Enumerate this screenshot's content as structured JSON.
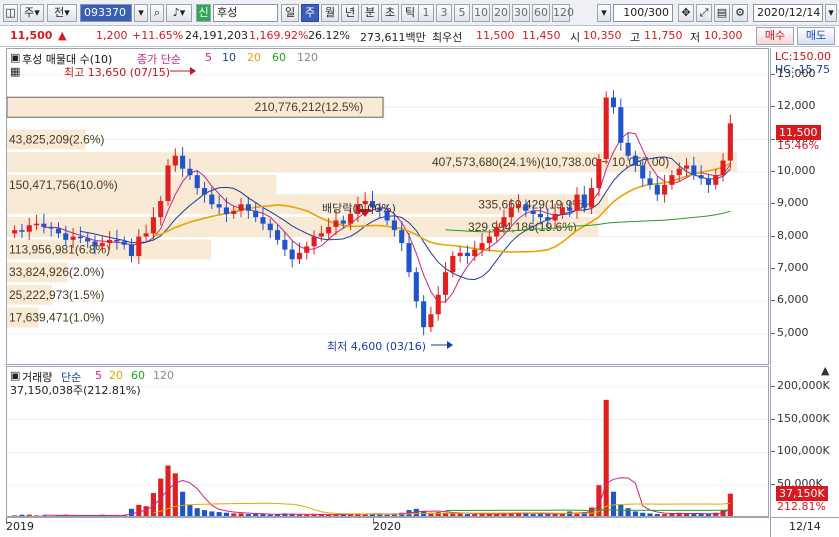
{
  "toolbar": {
    "market": "주",
    "prev": "전",
    "code": "093370",
    "name": "후성",
    "period_buttons": [
      "일",
      "주",
      "월",
      "년",
      "분",
      "초",
      "틱"
    ],
    "selected_period": "주",
    "interval_buttons": [
      "1",
      "3",
      "5",
      "10",
      "20",
      "30",
      "60",
      "120"
    ],
    "count": "100/300",
    "date": "2020/12/14",
    "new_badge": "신"
  },
  "quote": {
    "price": "11,500",
    "change_arrow": "▲",
    "change": "1,200",
    "change_pct": "+11.65%",
    "volume": "24,191,203",
    "volume_ratio": "1,169.92%",
    "turnover": "26.12%",
    "amount": "273,611백만",
    "best_ask_label": "최우선",
    "best_ask": "11,500",
    "best_bid": "11,450",
    "open_label": "시",
    "open": "10,350",
    "high_label": "고",
    "high": "11,750",
    "low_label": "저",
    "low": "10,300",
    "buy_button": "매수",
    "sell_button": "매도"
  },
  "price_panel": {
    "title": "후성 매물대 수(10)",
    "ma_label": "종가 단순",
    "ma_periods": [
      "5",
      "10",
      "20",
      "60",
      "120"
    ],
    "ma_colors": [
      "#cc2288",
      "#1a3c9e",
      "#e8a400",
      "#22a020",
      "#888888"
    ],
    "max_label": "최고 13,650 (07/15)",
    "min_label": "최저 4,600 (03/16)",
    "dividend_label": "배당락(0.00%)",
    "lc_label": "LC:150.00",
    "hc_label": "HC:-15.75",
    "axis_ticks": [
      "13,000",
      "12,000",
      "11,000",
      "10,000",
      "9,000",
      "8,000",
      "7,000",
      "6,000",
      "5,000"
    ],
    "current_price_tag": "11,500",
    "current_pct_tag": "15.46%",
    "volume_profile": [
      {
        "label": "210,776,212(12.5%)",
        "price": 12000,
        "value": 210776212
      },
      {
        "label": "43,825,209(2.6%)",
        "price": 11000,
        "value": 43825209
      },
      {
        "label": "407,573,680(24.1%)(10,738.00 ~ 10,057.00)",
        "price": 10300,
        "value": 407573680
      },
      {
        "label": "150,471,756(10.0%)",
        "price": 9600,
        "value": 150471756
      },
      {
        "label": "335,669,429(19.9%)",
        "price": 9000,
        "value": 335669429
      },
      {
        "label": "329,994,186(19.6%)",
        "price": 8300,
        "value": 329994186
      },
      {
        "label": "113,956,981(6.8%)",
        "price": 7600,
        "value": 113956981
      },
      {
        "label": "33,824,926(2.0%)",
        "price": 6900,
        "value": 33824926
      },
      {
        "label": "25,222,973(1.5%)",
        "price": 6200,
        "value": 25222973
      },
      {
        "label": "17,639,471(1.0%)",
        "price": 5500,
        "value": 17639471
      }
    ]
  },
  "volume_panel": {
    "title": "거래량",
    "ma_label": "단순",
    "ma_periods": [
      "5",
      "20",
      "60",
      "120"
    ],
    "last_value_label": "37,150,038주(212.81%)",
    "axis_ticks": [
      "200,000K",
      "150,000K",
      "100,000K",
      "50,000K"
    ],
    "current_vol_tag": "37,150K",
    "current_pct_tag": "212.81%"
  },
  "date_axis": {
    "labels": [
      "2019",
      "2020"
    ],
    "end_label": "12/14"
  },
  "chart_data": {
    "type": "candlestick",
    "title": "후성 매물대 수(10)",
    "weekly_close": [
      8200,
      8150,
      8350,
      8400,
      8300,
      8250,
      8100,
      7900,
      8000,
      7950,
      7850,
      7700,
      7800,
      7900,
      7850,
      7750,
      7400,
      8000,
      8100,
      8600,
      9100,
      10200,
      10500,
      10100,
      9900,
      9500,
      9300,
      9000,
      8900,
      8700,
      8800,
      9000,
      8800,
      8600,
      8400,
      8200,
      7900,
      7600,
      7300,
      7500,
      7700,
      8000,
      8100,
      8300,
      8500,
      8400,
      8700,
      9000,
      9100,
      8900,
      8800,
      8500,
      8200,
      7800,
      6900,
      6000,
      5200,
      5600,
      6200,
      6900,
      7400,
      7500,
      7400,
      7600,
      7800,
      8000,
      8300,
      8600,
      8900,
      9000,
      8800,
      8700,
      8600,
      8500,
      8700,
      8900,
      8800,
      9300,
      8900,
      9500,
      10400,
      12300,
      12000,
      10900,
      10500,
      10200,
      9800,
      9600,
      9300,
      9600,
      9900,
      10100,
      10200,
      9900,
      9800,
      9600,
      9900,
      10350,
      11500
    ],
    "weekly_volume": [
      4,
      5,
      5,
      4,
      4,
      3,
      4,
      5,
      4,
      3,
      3,
      4,
      5,
      4,
      4,
      4,
      14,
      20,
      18,
      38,
      60,
      80,
      68,
      40,
      20,
      15,
      12,
      10,
      9,
      8,
      7,
      7,
      6,
      6,
      6,
      5,
      6,
      7,
      6,
      5,
      5,
      5,
      6,
      5,
      5,
      6,
      6,
      7,
      6,
      6,
      6,
      5,
      7,
      8,
      12,
      14,
      10,
      8,
      9,
      8,
      7,
      7,
      6,
      6,
      6,
      6,
      6,
      8,
      8,
      7,
      7,
      6,
      6,
      6,
      6,
      7,
      10,
      8,
      9,
      16,
      50,
      180,
      40,
      20,
      15,
      10,
      8,
      7,
      6,
      6,
      7,
      8,
      7,
      6,
      6,
      6,
      8,
      12,
      37
    ],
    "ylim": [
      4000,
      13800
    ],
    "vol_ylim": [
      0,
      230000
    ],
    "unit_price": "KRW",
    "unit_volume": "K shares"
  }
}
